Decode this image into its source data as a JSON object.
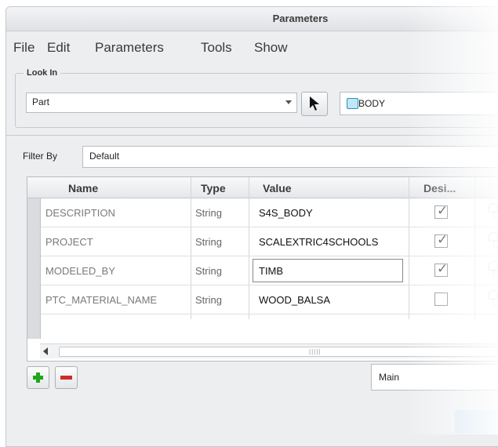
{
  "window": {
    "title": "Parameters"
  },
  "menu": [
    "File",
    "Edit",
    "Parameters",
    "Tools",
    "Show"
  ],
  "look_in": {
    "legend": "Look In",
    "selected": "Part",
    "object": "BODY"
  },
  "filter": {
    "label": "Filter By",
    "value": "Default"
  },
  "table": {
    "columns": [
      "Name",
      "Type",
      "Value",
      "Desi..."
    ],
    "rows": [
      {
        "name": "DESCRIPTION",
        "type": "String",
        "value": "S4S_BODY",
        "designated": true
      },
      {
        "name": "PROJECT",
        "type": "String",
        "value": "SCALEXTRIC4SCHOOLS",
        "designated": true
      },
      {
        "name": "MODELED_BY",
        "type": "String",
        "value": "TIMB",
        "designated": true
      },
      {
        "name": "PTC_MATERIAL_NAME",
        "type": "String",
        "value": "WOOD_BALSA",
        "designated": false
      }
    ]
  },
  "bottom": {
    "view_select": "Main"
  },
  "icons": {
    "add": "plus-icon",
    "remove": "minus-icon",
    "pick": "arrow-pointer-icon",
    "part": "part-body-icon",
    "lock": "lock-icon"
  },
  "colors": {
    "add": "#1ea71b",
    "remove": "#d12a2a",
    "accent": "#2a8fbf"
  }
}
